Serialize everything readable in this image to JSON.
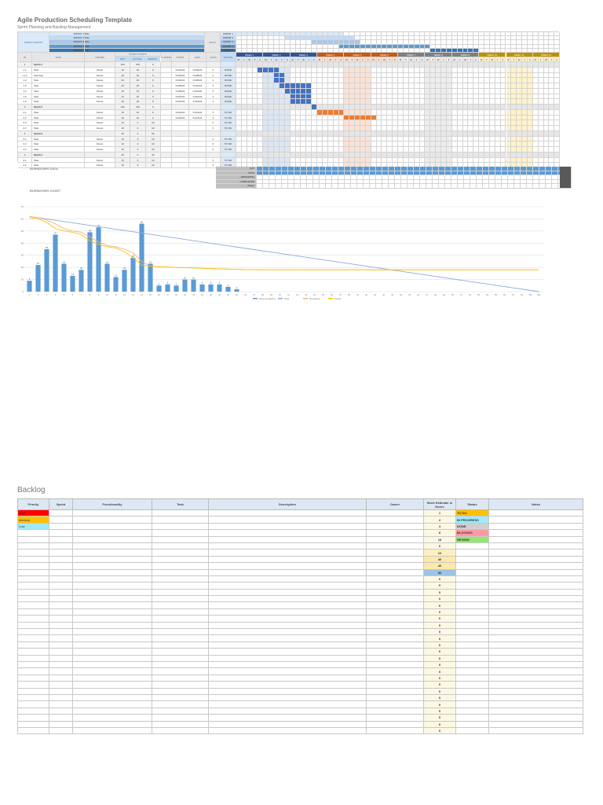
{
  "title": "Agile Production Scheduling Template",
  "subtitle": "Sprint Planning and Backlog Management",
  "legend": {
    "label": "SPRINT STATUS",
    "rows": [
      {
        "key": "SPRINT 1",
        "label": "Plan",
        "color": "#dce9f7",
        "start": 0,
        "end": 19
      },
      {
        "key": "SPRINT 2",
        "label": "Plan",
        "color": "#c5dbf1",
        "start": 9,
        "end": 21
      },
      {
        "key": "SPRINT 3",
        "label": "Plan",
        "color": "#a9c8ea",
        "start": 14,
        "end": 22
      },
      {
        "key": "SPRINT 4",
        "label": "Plan",
        "color": "#5b9bd5",
        "start": 19,
        "end": 35
      },
      {
        "key": "SPRINT 5",
        "label": "Plan",
        "color": "#2e75b6",
        "start": 36,
        "end": 44
      }
    ],
    "side": "DAYS"
  },
  "table_headers": {
    "id": "ID",
    "task": "TASK",
    "owner": "OWNER",
    "points": "STORY POINTS",
    "p1": "EST",
    "p2": "ACTUAL",
    "p3": "REMAIN",
    "pct": "% DONE",
    "start": "START",
    "end": "END",
    "days": "DAYS",
    "status": "STATUS"
  },
  "weeks": [
    {
      "label": "WEEK 1",
      "color": "#2f5597",
      "light": "#dce6f4"
    },
    {
      "label": "WEEK 2",
      "color": "#2f5597",
      "light": "#dce6f4"
    },
    {
      "label": "WEEK 3",
      "color": "#2f5597",
      "light": "#dce6f4"
    },
    {
      "label": "WEEK 4",
      "color": "#c55a11",
      "light": "#fbe2d5"
    },
    {
      "label": "WEEK 5",
      "color": "#c55a11",
      "light": "#fbe2d5"
    },
    {
      "label": "WEEK 6",
      "color": "#c55a11",
      "light": "#fbe2d5"
    },
    {
      "label": "WEEK 7",
      "color": "#7f7f7f",
      "light": "#ededed"
    },
    {
      "label": "WEEK 8",
      "color": "#7f7f7f",
      "light": "#ededed"
    },
    {
      "label": "WEEK 9",
      "color": "#7f7f7f",
      "light": "#ededed"
    },
    {
      "label": "WEEK 10",
      "color": "#bf8f00",
      "light": "#fff2cc"
    },
    {
      "label": "WEEK 11",
      "color": "#bf8f00",
      "light": "#fff2cc"
    },
    {
      "label": "WEEK 12",
      "color": "#bf8f00",
      "light": "#fff2cc"
    }
  ],
  "day_letters": [
    "M",
    "T",
    "W",
    "T",
    "F"
  ],
  "tasks": [
    {
      "id": "1",
      "task": "Sprint 1",
      "owner": "",
      "p1": "100",
      "p2": "100",
      "p3": "0",
      "start": "",
      "end": "",
      "days": "",
      "status": "",
      "group": true
    },
    {
      "id": "1.1",
      "task": "Task",
      "owner": "Owner",
      "p1": "10",
      "p2": "10",
      "p3": "0",
      "start": "01/01/24",
      "end": "01/04/24",
      "days": "4",
      "status": "DONE",
      "bar": [
        4,
        7
      ],
      "barColor": "#4472c4"
    },
    {
      "id": "1.1.1",
      "task": "Sub-task",
      "owner": "Owner",
      "p1": "10",
      "p2": "10",
      "p3": "0",
      "start": "01/04/24",
      "end": "01/05/24",
      "days": "2",
      "status": "DONE",
      "bar": [
        7,
        8
      ],
      "barColor": "#4472c4"
    },
    {
      "id": "1.2",
      "task": "Task",
      "owner": "Owner",
      "p1": "20",
      "p2": "20",
      "p3": "0",
      "start": "01/04/24",
      "end": "01/05/24",
      "days": "2",
      "status": "DONE",
      "bar": [
        7,
        8
      ],
      "barColor": "#4472c4"
    },
    {
      "id": "1.3",
      "task": "Task",
      "owner": "Owner",
      "p1": "20",
      "p2": "20",
      "p3": "0",
      "start": "01/05/24",
      "end": "01/10/24",
      "days": "6",
      "status": "DONE",
      "bar": [
        8,
        13
      ],
      "barColor": "#4472c4"
    },
    {
      "id": "1.4",
      "task": "Task",
      "owner": "Owner",
      "p1": "10",
      "p2": "10",
      "p3": "0",
      "start": "01/06/24",
      "end": "01/10/24",
      "days": "5",
      "status": "DONE",
      "bar": [
        9,
        13
      ],
      "barColor": "#4472c4"
    },
    {
      "id": "1.5",
      "task": "Task",
      "owner": "Owner",
      "p1": "10",
      "p2": "10",
      "p3": "0",
      "start": "01/07/24",
      "end": "01/10/24",
      "days": "4",
      "status": "DONE",
      "bar": [
        10,
        13
      ],
      "barColor": "#4472c4"
    },
    {
      "id": "1.6",
      "task": "Task",
      "owner": "Owner",
      "p1": "10",
      "p2": "10",
      "p3": "0",
      "start": "01/07/24",
      "end": "01/10/24",
      "days": "4",
      "status": "DONE",
      "bar": [
        10,
        13
      ],
      "barColor": "#4472c4"
    },
    {
      "id": "2",
      "task": "Sprint 2",
      "owner": "",
      "p1": "100",
      "p2": "100",
      "p3": "0",
      "start": "",
      "end": "",
      "days": "",
      "status": "",
      "group": true,
      "bar": [
        14,
        14
      ],
      "barColor": "#4472c4"
    },
    {
      "id": "2.1",
      "task": "Task",
      "owner": "Owner",
      "p1": "10",
      "p2": "10",
      "p3": "0",
      "start": "01/15/24",
      "end": "01/19/24",
      "days": "5",
      "status": "TO DO",
      "bar": [
        15,
        19
      ],
      "barColor": "#ed7d31"
    },
    {
      "id": "2.2",
      "task": "Task",
      "owner": "Owner",
      "p1": "10",
      "p2": "10",
      "p3": "0",
      "start": "01/22/24",
      "end": "01/27/24",
      "days": "6",
      "status": "TO DO",
      "bar": [
        20,
        25
      ],
      "barColor": "#ed7d31"
    },
    {
      "id": "2.3",
      "task": "Task",
      "owner": "Owner",
      "p1": "10",
      "p2": "0",
      "p3": "10",
      "start": "",
      "end": "",
      "days": "0",
      "status": "TO DO"
    },
    {
      "id": "2.4",
      "task": "Task",
      "owner": "Owner",
      "p1": "10",
      "p2": "0",
      "p3": "10",
      "start": "",
      "end": "",
      "days": "0",
      "status": "TO DO"
    },
    {
      "id": "3",
      "task": "Sprint 3",
      "owner": "",
      "p1": "30",
      "p2": "0",
      "p3": "30",
      "start": "",
      "end": "",
      "days": "",
      "status": "",
      "group": true
    },
    {
      "id": "3.1",
      "task": "Task",
      "owner": "Owner",
      "p1": "10",
      "p2": "0",
      "p3": "10",
      "start": "",
      "end": "",
      "days": "0",
      "status": "TO DO"
    },
    {
      "id": "3.2",
      "task": "Task",
      "owner": "Owner",
      "p1": "10",
      "p2": "0",
      "p3": "10",
      "start": "",
      "end": "",
      "days": "0",
      "status": "TO DO"
    },
    {
      "id": "3.3",
      "task": "Task",
      "owner": "Owner",
      "p1": "10",
      "p2": "0",
      "p3": "10",
      "start": "",
      "end": "",
      "days": "0",
      "status": "TO DO"
    },
    {
      "id": "4",
      "task": "Sprint 4",
      "owner": "",
      "p1": "30",
      "p2": "0",
      "p3": "30",
      "start": "",
      "end": "",
      "days": "",
      "status": "",
      "group": true
    },
    {
      "id": "4.1",
      "task": "Task",
      "owner": "Owner",
      "p1": "10",
      "p2": "0",
      "p3": "10",
      "start": "",
      "end": "",
      "days": "0",
      "status": "TO DO"
    },
    {
      "id": "4.2",
      "task": "Task",
      "owner": "Owner",
      "p1": "10",
      "p2": "0",
      "p3": "10",
      "start": "",
      "end": "",
      "days": "0",
      "status": "TO DO"
    }
  ],
  "burndown_data": {
    "title": "BURNDOWN DATA",
    "row_labels": [
      "DAY",
      "DATE",
      "REMAINING",
      "COMPLETED",
      "IDEAL"
    ]
  },
  "chart_data": {
    "type": "bar",
    "title": "BURNDOWN CHART",
    "ylim": [
      0,
      70
    ],
    "yticks": [
      0,
      10,
      20,
      30,
      40,
      50,
      60,
      70
    ],
    "x": [
      1,
      2,
      3,
      4,
      5,
      6,
      7,
      8,
      9,
      10,
      11,
      12,
      13,
      14,
      15,
      16,
      17,
      18,
      19,
      20,
      21,
      22,
      23,
      24,
      25,
      26,
      27,
      28,
      29,
      30,
      31,
      32,
      33,
      34,
      35,
      36,
      37,
      38,
      39,
      40,
      41,
      42,
      43,
      44,
      45,
      46,
      47,
      48,
      49,
      50,
      51,
      52,
      53,
      54,
      55,
      56,
      57,
      58,
      59,
      60
    ],
    "series": [
      {
        "name": "Daily Completed",
        "type": "bar",
        "color": "#5b9bd5",
        "values": [
          9,
          22,
          35,
          47,
          23,
          13,
          18,
          49,
          53,
          23,
          12,
          18,
          28,
          56,
          23,
          5,
          6,
          5,
          10,
          10,
          6,
          6,
          6,
          4,
          2,
          0,
          0,
          0,
          0,
          0,
          0,
          0,
          0,
          0,
          0,
          0,
          0,
          0,
          0,
          0,
          0,
          0,
          0,
          0,
          0,
          0,
          0,
          0,
          0,
          0,
          0,
          0,
          0,
          0,
          0,
          0,
          0,
          0,
          0,
          0
        ]
      },
      {
        "name": "Ideal",
        "type": "line",
        "color": "#8faadc",
        "values": "linear:62:0"
      },
      {
        "name": "Remaining",
        "type": "line",
        "color": "#f4b183",
        "values": [
          62,
          61,
          59,
          56,
          52,
          50,
          49,
          45,
          41,
          38,
          37,
          35,
          32,
          25,
          21,
          20.5,
          20.3,
          20,
          19.8,
          19.6,
          19.3,
          19,
          18.8,
          18.6,
          18.4,
          18.2,
          18.1,
          18,
          18,
          18
        ]
      },
      {
        "name": "Actual",
        "type": "line",
        "color": "#ffc000",
        "values": [
          61,
          60,
          57,
          52,
          50,
          49,
          47,
          42,
          39,
          37,
          36,
          33,
          28,
          22,
          21,
          20.6,
          20.3,
          20,
          19.8,
          19.6,
          19.3,
          19,
          18.8,
          18.6,
          18.4,
          18.2,
          18.1,
          18,
          18,
          18
        ]
      }
    ]
  },
  "backlog": {
    "title": "Backlog",
    "headers": [
      "Priority",
      "Sprint",
      "Functionality",
      "Task",
      "Description",
      "Owner",
      "Work Estimate in Hours",
      "Status",
      "Notes"
    ],
    "priorities": [
      {
        "label": "High",
        "color": "#ff0000"
      },
      {
        "label": "Medium",
        "color": "#ffc000"
      },
      {
        "label": "Low",
        "color": "#9eeaf9"
      }
    ],
    "statuses": [
      {
        "label": "TO DO",
        "color": "#ffc000"
      },
      {
        "label": "IN PROGRESS",
        "color": "#9eeaf9"
      },
      {
        "label": "DONE",
        "color": "#d0d0d0"
      },
      {
        "label": "BLOCKED",
        "color": "#ff99a6"
      },
      {
        "label": "REVIEW",
        "color": "#92e86e"
      }
    ],
    "estimates": [
      "1",
      "2",
      "4",
      "8",
      "16",
      "0",
      "24",
      "40",
      "40",
      "80",
      "0",
      "0",
      "0",
      "0",
      "0",
      "0",
      "0",
      "0",
      "0",
      "0",
      "0",
      "0",
      "0",
      "0",
      "0",
      "0",
      "0",
      "0",
      "0",
      "0",
      "0",
      "0",
      "0",
      "0"
    ],
    "estimate_colors": {
      "2": "#fdf8e4",
      "6": "#fdf0c0",
      "7": "#fde9a8",
      "8": "#fde9a8",
      "9": "#9dc3e6"
    }
  }
}
